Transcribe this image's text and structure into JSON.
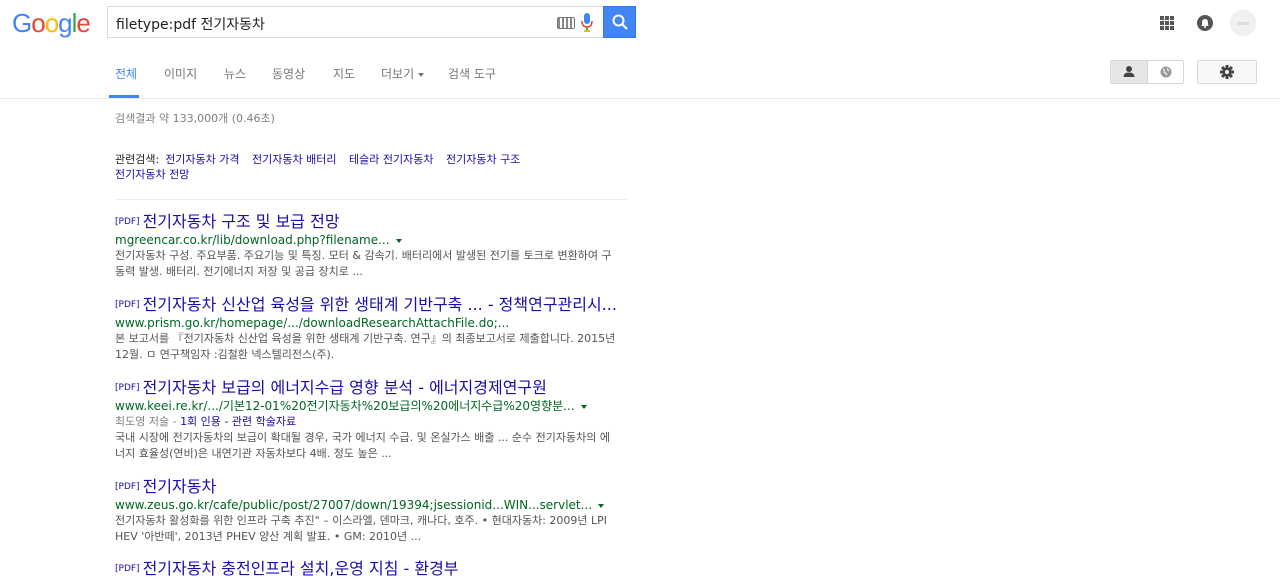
{
  "header": {
    "logo": [
      "G",
      "o",
      "o",
      "g",
      "l",
      "e"
    ],
    "logo_colors": [
      "#4285f4",
      "#ea4335",
      "#fbbc05",
      "#4285f4",
      "#34a853",
      "#ea4335"
    ],
    "query": "filetype:pdf 전기자동차"
  },
  "tabs": [
    {
      "label": "전체"
    },
    {
      "label": "이미지"
    },
    {
      "label": "뉴스"
    },
    {
      "label": "동영상"
    },
    {
      "label": "지도"
    },
    {
      "label": "더보기"
    },
    {
      "label": "검색 도구"
    }
  ],
  "stats": "검색결과 약 133,000개 (0.46초)",
  "related": {
    "label": "관련검색:",
    "items": [
      "전기자동차 가격",
      "전기자동차 배터리",
      "테슬라 전기자동차",
      "전기자동차 구조",
      "전기자동차 전망"
    ]
  },
  "results": [
    {
      "tag": "[PDF]",
      "title": "전기자동차 구조 및 보급 전망",
      "url": "mgreencar.co.kr/lib/download.php?filename...",
      "meta": "",
      "meta_link": "",
      "snippet": "전기자동차 구성. 주요부품. 주요기능 및 특징. 모터 & 감속기. 배터리에서 발생된 전기를 토크로 변환하여 구동력 발생. 배터리. 전기에너지 저장 및 공급 장치로 ..."
    },
    {
      "tag": "[PDF]",
      "title": "전기자동차 신산업 육성을 위한 생태계 기반구축 ... - 정책연구관리시...",
      "url": "www.prism.go.kr/homepage/.../downloadResearchAttachFile.do;...",
      "meta": "",
      "meta_link": "",
      "snippet": "본 보고서를 『전기자동차 신산업 육성을 위한 생태계 기반구축. 연구』의 최종보고서로 제출합니다. 2015년 12월. ㅁ 연구책임자 :김철환 넥스텔리전스(주)."
    },
    {
      "tag": "[PDF]",
      "title": "전기자동차 보급의 에너지수급 영향 분석 - 에너지경제연구원",
      "url": "www.keei.re.kr/.../기본12-01%20전기자동차%20보급의%20에너지수급%20영향분...",
      "meta": "최도영 저술 - ",
      "meta_link": "1회 인용 - 관련 학술자료",
      "snippet": "국내 시장에 전기자동차의 보급이 확대될 경우, 국가 에너지 수급. 및 온실가스 배출 ... 순수 전기자동차의 에너지 효율성(연비)은 내연기관 자동차보다 4배. 정도 높은 ..."
    },
    {
      "tag": "[PDF]",
      "title": "전기자동차",
      "url": "www.zeus.go.kr/cafe/public/post/27007/down/19394;jsessionid...WIN...servlet...",
      "meta": "",
      "meta_link": "",
      "snippet": "전기자동차 활성화를 위한 인프라 구축 추진\" – 이스라엘, 덴마크, 캐나다, 호주. • 현대자동차: 2009년 LPI HEV '아반떼', 2013년 PHEV 양산 계획 발표. • GM: 2010년 ..."
    },
    {
      "tag": "[PDF]",
      "title": "전기자동차 충전인프라 설치,운영 지침 - 환경부",
      "url": "",
      "meta": "",
      "meta_link": "",
      "snippet": ""
    }
  ]
}
